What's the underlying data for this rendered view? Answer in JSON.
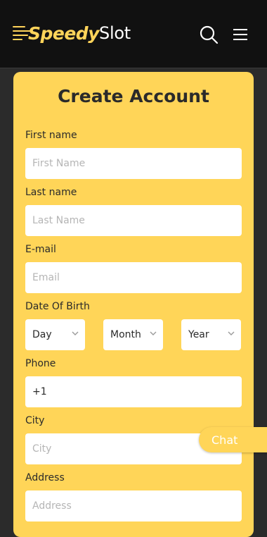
{
  "header": {
    "logo": {
      "part1": "Speedy",
      "part2": "Slot"
    }
  },
  "form": {
    "title": "Create Account",
    "first_name": {
      "label": "First name",
      "placeholder": "First Name"
    },
    "last_name": {
      "label": "Last name",
      "placeholder": "Last Name"
    },
    "email": {
      "label": "E-mail",
      "placeholder": "Email"
    },
    "dob": {
      "label": "Date Of Birth",
      "day": "Day",
      "month": "Month",
      "year": "Year"
    },
    "phone": {
      "label": "Phone",
      "value": "+1"
    },
    "city": {
      "label": "City",
      "placeholder": "City"
    },
    "address": {
      "label": "Address",
      "placeholder": "Address"
    }
  },
  "chat": {
    "label": "Chat"
  },
  "colors": {
    "accent": "#ffd558",
    "header_bg": "#111111",
    "page_bg": "#2b2b2b"
  },
  "icons": {
    "search": "search-icon",
    "menu": "hamburger-menu-icon",
    "chevron": "chevron-down-icon"
  }
}
